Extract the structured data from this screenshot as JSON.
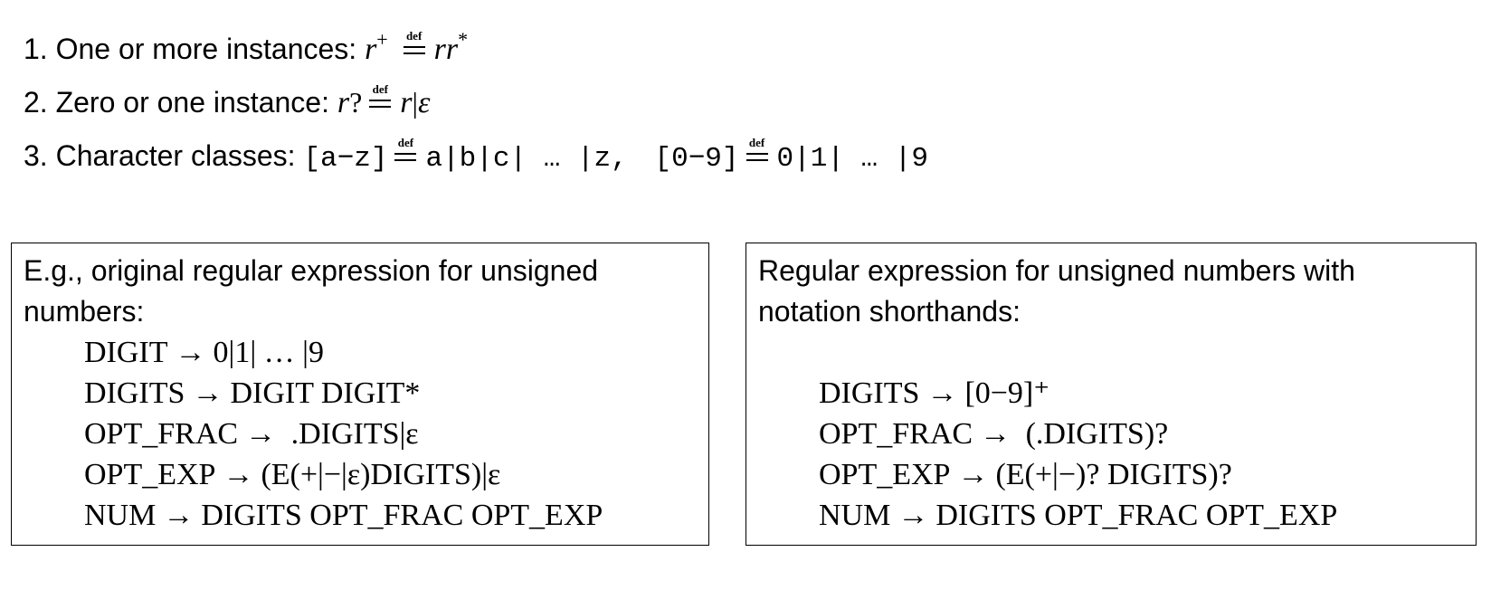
{
  "rules": [
    {
      "label": "1. One or more instances:",
      "lhs_var": "r",
      "lhs_sup": "+",
      "defeq_label": "def",
      "rhs_var": "rr",
      "rhs_sup": "*"
    },
    {
      "label": "2. Zero or one instance:",
      "lhs_var": "r",
      "lhs_op": "?",
      "defeq_label": "def",
      "rhs_var": "r",
      "rhs_op": "|",
      "rhs_eps": "ε"
    },
    {
      "label": "3. Character classes:",
      "class1": "[a−z]",
      "defeq_label": "def",
      "expand1": "a|b|c| … |z,",
      "class2": "[0−9]",
      "expand2": "0|1| … |9"
    }
  ],
  "left_box": {
    "title_line1": "E.g., original regular expression for unsigned",
    "title_line2": "numbers:",
    "productions": [
      {
        "lhs": "DIGIT",
        "arrow": "→",
        "rhs": "0|1| … |9"
      },
      {
        "lhs": "DIGITS",
        "arrow": "→",
        "rhs": "DIGIT DIGIT*"
      },
      {
        "lhs": "OPT_FRAC",
        "arrow": "→",
        "rhs": " .DIGITS|ε"
      },
      {
        "lhs": "OPT_EXP",
        "arrow": "→",
        "rhs": "(E(+|−|ε)DIGITS)|ε"
      },
      {
        "lhs": "NUM",
        "arrow": "→",
        "rhs": "DIGITS  OPT_FRAC  OPT_EXP"
      }
    ]
  },
  "right_box": {
    "title_line1": "Regular expression for unsigned numbers with",
    "title_line2": "notation shorthands:",
    "productions": [
      {
        "lhs": "DIGITS",
        "arrow": "→",
        "rhs": "[0−9]⁺"
      },
      {
        "lhs": "OPT_FRAC",
        "arrow": "→",
        "rhs": " (.DIGITS)?"
      },
      {
        "lhs": "OPT_EXP",
        "arrow": "→",
        "rhs": "(E(+|−)? DIGITS)?"
      },
      {
        "lhs": "NUM",
        "arrow": "→",
        "rhs": "DIGITS  OPT_FRAC  OPT_EXP"
      }
    ]
  }
}
